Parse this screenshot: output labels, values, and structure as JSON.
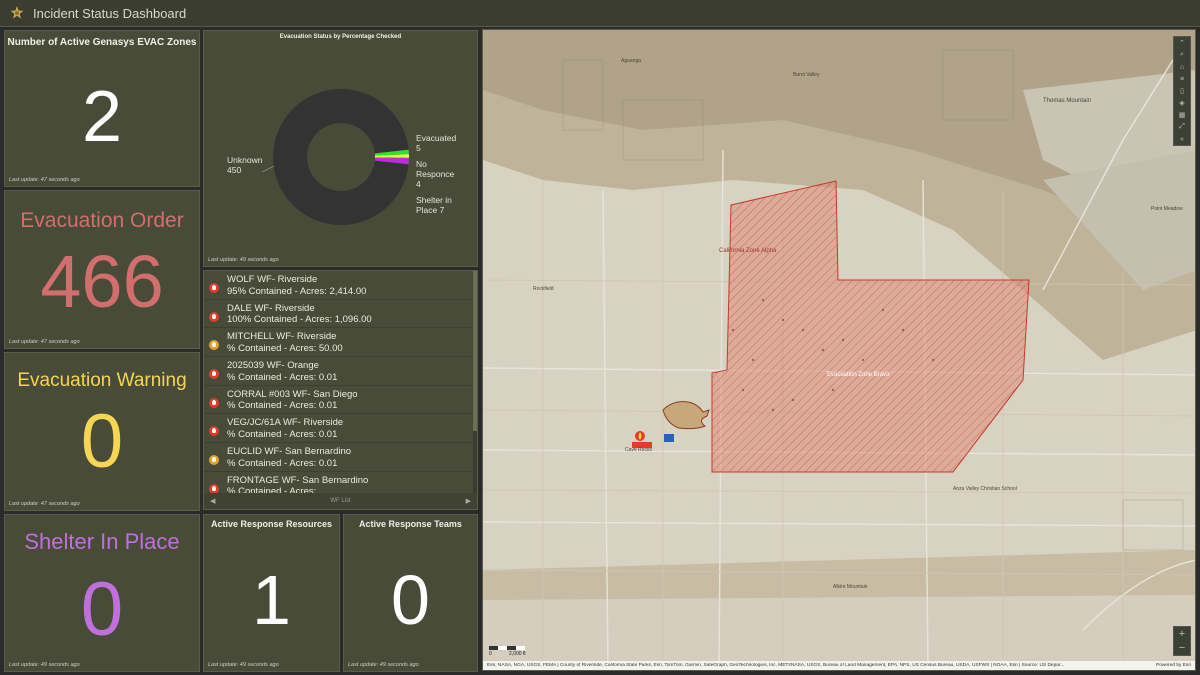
{
  "header": {
    "title": "Incident Status Dashboard"
  },
  "active_zones": {
    "title": "Number of Active Genasys EVAC Zones",
    "value": "2",
    "last_update": "Last update: 47 seconds ago"
  },
  "evac_order": {
    "title": "Evacuation Order",
    "value": "466",
    "color": "#d36e6e",
    "last_update": "Last update: 47 seconds ago"
  },
  "evac_warning": {
    "title": "Evacuation Warning",
    "value": "0",
    "color": "#f5d552",
    "last_update": "Last update: 47 seconds ago"
  },
  "shelter": {
    "title": "Shelter In Place",
    "value": "0",
    "color": "#c070dc",
    "last_update": "Last update: 49 seconds ago"
  },
  "resources": {
    "title": "Active Response Resources",
    "value": "1",
    "last_update": "Last update: 49 seconds ago"
  },
  "teams": {
    "title": "Active Response Teams",
    "value": "0",
    "last_update": "Last update: 49 seconds ago"
  },
  "donut": {
    "title": "Evacuation Status by Percentage Checked",
    "last_update": "Last update: 49 seconds ago",
    "labels": {
      "unknown": "Unknown",
      "unknown_val": "450",
      "evacuated": "Evacuated",
      "evacuated_val": "5",
      "noresp": "No",
      "noresp2": "Responce",
      "noresp_val": "4",
      "shelter": "Shelter in",
      "shelter2": "Place 7"
    }
  },
  "chart_data": {
    "type": "pie",
    "title": "Evacuation Status by Percentage Checked",
    "categories": [
      "Unknown",
      "Evacuated",
      "No Responce",
      "Shelter in Place"
    ],
    "values": [
      450,
      5,
      4,
      7
    ],
    "colors": [
      "#333333",
      "#2de22d",
      "#e8ff3a",
      "#b72fd8"
    ]
  },
  "wildfires": {
    "footer_label": "WF List",
    "items": [
      {
        "line1": "WOLF WF- Riverside",
        "line2": "95% Contained - Acres: 2,414.00",
        "icon": "fire-icon"
      },
      {
        "line1": "DALE WF- Riverside",
        "line2": "100% Contained - Acres: 1,096.00",
        "icon": "fire-icon"
      },
      {
        "line1": "MITCHELL WF- Riverside",
        "line2": "% Contained - Acres: 50.00",
        "icon": "fire-contained-icon"
      },
      {
        "line1": "2025039 WF- Orange",
        "line2": "% Contained - Acres: 0.01",
        "icon": "fire-icon"
      },
      {
        "line1": "CORRAL #003 WF- San Diego",
        "line2": "% Contained - Acres: 0.01",
        "icon": "fire-icon"
      },
      {
        "line1": "VEG/JC/61A WF- Riverside",
        "line2": "% Contained - Acres: 0.01",
        "icon": "fire-icon"
      },
      {
        "line1": "EUCLID WF- San Bernardino",
        "line2": "% Contained - Acres: 0.01",
        "icon": "fire-contained-icon"
      },
      {
        "line1": "FRONTAGE WF- San Bernardino",
        "line2": "% Contained - Acres:",
        "icon": "fire-icon"
      }
    ]
  },
  "map": {
    "attribution": "Esri, NASA, NGA, USGS, FEMA | County of Riverside, California State Parks, Esri, TomTom, Garmin, SafeGraph, GeoTechnologies, Inc, METI/NASA, USGS, Bureau of Land Management, EPA, NPS, US Census Bureau, USDA, USFWS | NOAA, Esri | Source: US Depar...",
    "powered": "Powered by Esri",
    "scale_left": "0",
    "scale_right": "2,000 ft",
    "labels": {
      "thomas_mountain": "Thomas Mountain",
      "zone1": "California Zone Alpha",
      "zone2": "Evacuation Zone Bravo",
      "aguanga": "Aguanga",
      "cave_rocks": "Cave Rocks",
      "anza_valley": "Anza Valley Christian School",
      "alkire_mountain": "Alkire Mountain",
      "burnt_valley": "Burnt Valley",
      "point_meadow": "Point Meadow",
      "rockfield": "Rockfield"
    }
  }
}
